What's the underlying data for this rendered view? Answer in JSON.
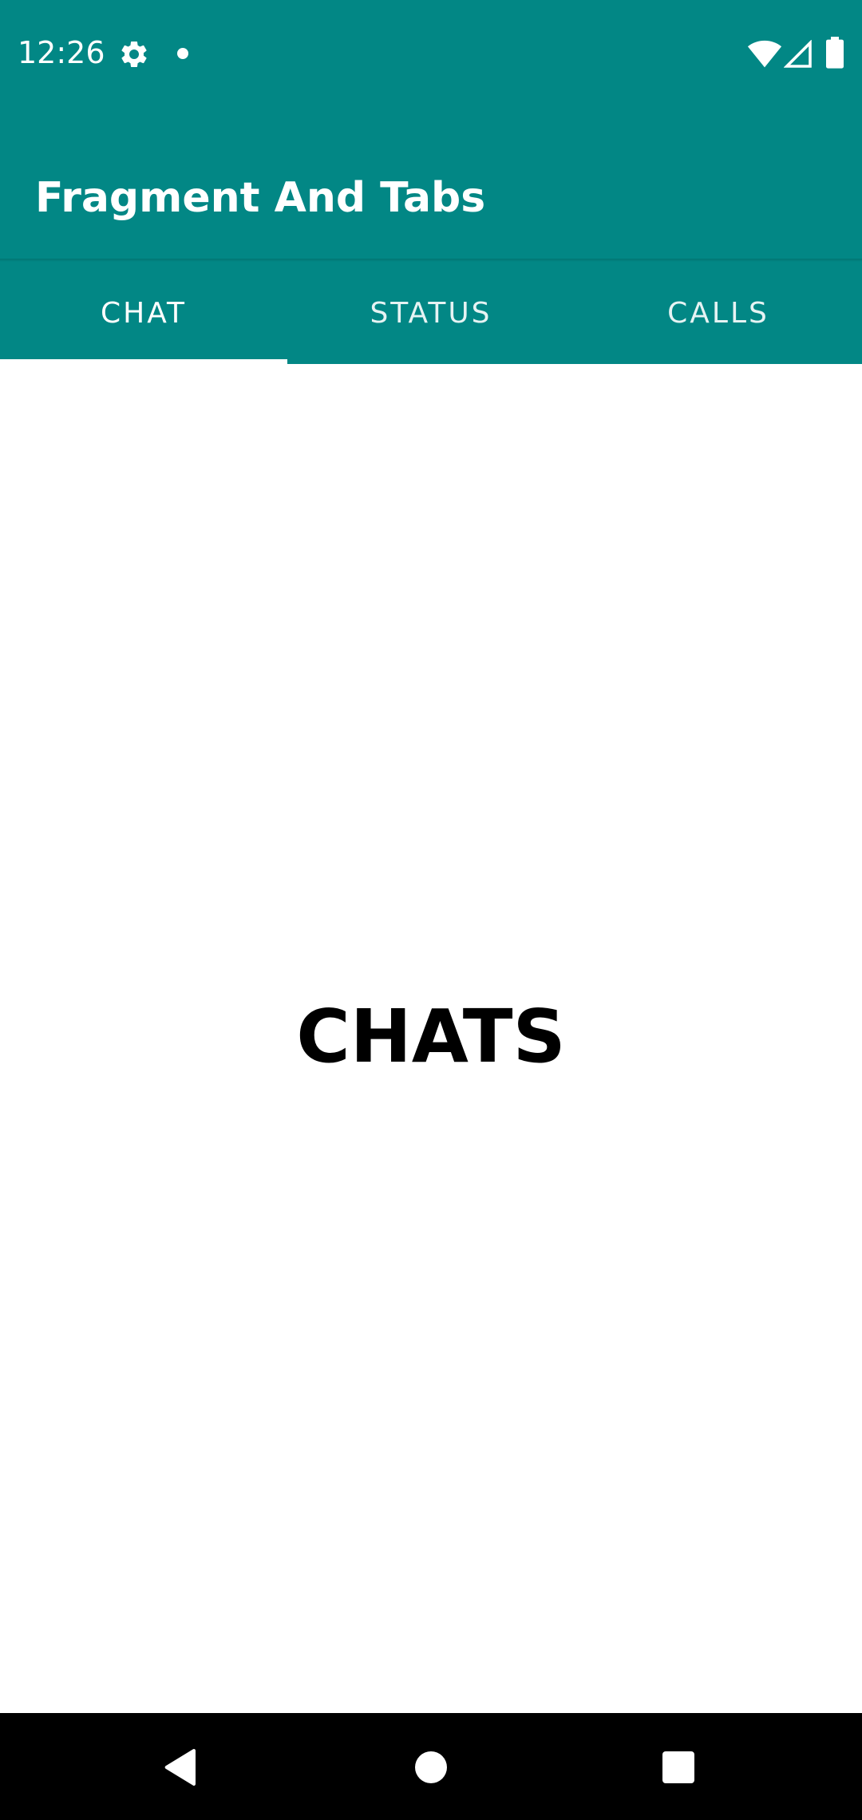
{
  "status_bar": {
    "time": "12:26",
    "icons": [
      "gear-icon",
      "notification-dot-icon",
      "wifi-icon",
      "cellular-signal-icon",
      "battery-icon"
    ]
  },
  "app_bar": {
    "title": "Fragment And Tabs"
  },
  "tabs": [
    {
      "label": "CHAT",
      "selected": true
    },
    {
      "label": "STATUS",
      "selected": false
    },
    {
      "label": "CALLS",
      "selected": false
    }
  ],
  "content": {
    "text": "CHATS"
  },
  "nav_bar": {
    "icons": [
      "back-icon",
      "home-icon",
      "recents-icon"
    ]
  },
  "colors": {
    "primary": "#028785",
    "on_primary": "#ffffff",
    "background": "#ffffff",
    "nav_bar": "#000000"
  }
}
